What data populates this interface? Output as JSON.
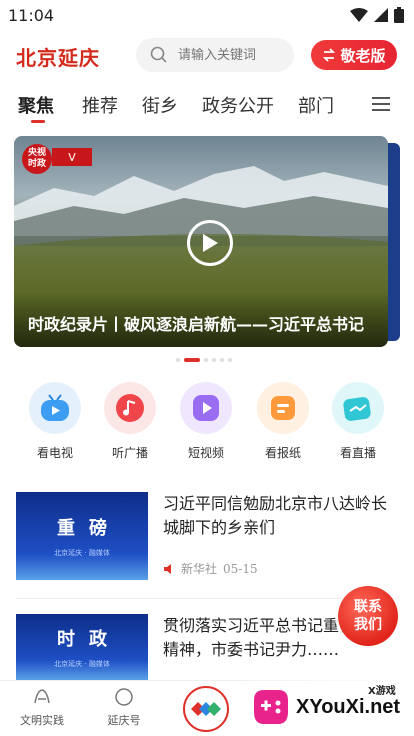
{
  "status": {
    "time": "11:04"
  },
  "header": {
    "logo": "北京延庆",
    "search_placeholder": "请输入关键词",
    "elder_button": "敬老版"
  },
  "tabs": [
    "聚焦",
    "推荐",
    "街乡",
    "政务公开",
    "部门"
  ],
  "banner": {
    "badge_line1": "央视",
    "badge_line2": "时政",
    "flag": "V",
    "title": "时政纪录片丨破风逐浪启新航——习近平总书记",
    "active_dot": 1
  },
  "quick_links": [
    {
      "label": "看电视",
      "icon": "tv-icon",
      "color": "#3d9df2"
    },
    {
      "label": "听广播",
      "icon": "radio-icon",
      "color": "#f0454a"
    },
    {
      "label": "短视频",
      "icon": "short-video-icon",
      "color": "#9a6cf2"
    },
    {
      "label": "看报纸",
      "icon": "newspaper-icon",
      "color": "#ff9a3c"
    },
    {
      "label": "看直播",
      "icon": "live-icon",
      "color": "#31c6d3"
    }
  ],
  "news": [
    {
      "thumb_big": "重磅",
      "thumb_small": "北京延庆 · 融媒体",
      "title": "习近平同信勉励北京市八达岭长城脚下的乡亲们",
      "source": "新华社",
      "date": "05-15"
    },
    {
      "thumb_big": "时政",
      "thumb_small": "北京延庆 · 融媒体",
      "title": "贯彻落实习近平总书记重要回信精神，市委书记尹力……"
    }
  ],
  "contact_button": "联系我们",
  "bottom_nav": [
    {
      "label": "文明实践",
      "icon": "civilization-icon"
    },
    {
      "label": "延庆号",
      "icon": "yanqing-icon"
    }
  ],
  "watermark": {
    "top": "X游戏",
    "main": "XYouXi.net"
  }
}
